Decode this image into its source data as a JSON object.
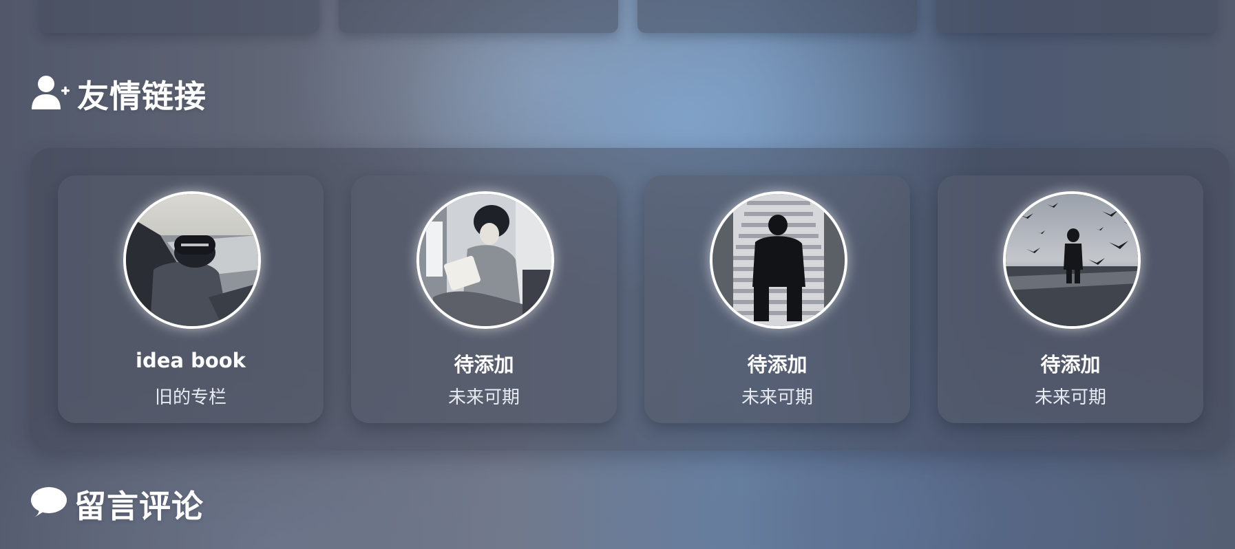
{
  "friends_section": {
    "title": "友情链接",
    "icon": "add-user-icon"
  },
  "friends": [
    {
      "name": "idea book",
      "desc": "旧的专栏",
      "avatar": "avatar-seaside-cap"
    },
    {
      "name": "待添加",
      "desc": "未来可期",
      "avatar": "avatar-reading-train"
    },
    {
      "name": "待添加",
      "desc": "未来可期",
      "avatar": "avatar-stairs-sitting"
    },
    {
      "name": "待添加",
      "desc": "未来可期",
      "avatar": "avatar-birds-water"
    }
  ],
  "comments_section": {
    "title": "留言评论",
    "icon": "comment-icon"
  }
}
